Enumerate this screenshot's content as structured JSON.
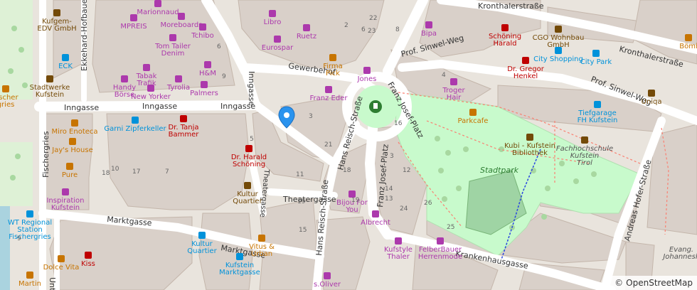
{
  "colors": {
    "background": "#e9e4dd",
    "building": "#d9d0c9",
    "road": "#ffffff",
    "park": "#c8facc",
    "shop_icon": "#ac39ac",
    "amenity_icon": "#734a08",
    "health_icon": "#bf0000",
    "transport_icon": "#0092da",
    "food_icon": "#c77400",
    "label": "#333333",
    "poi_label_shop": "#ac39ac",
    "poi_label_amenity": "#734a08",
    "poi_label_health": "#bf0000",
    "poi_label_transport": "#0092da",
    "poi_label_food": "#c77400",
    "marker": "#2a93ee"
  },
  "streets": [
    {
      "name": "Inngasse",
      "id": "inngasse-1"
    },
    {
      "name": "Inngasse",
      "id": "inngasse-2"
    },
    {
      "name": "Inngasse",
      "id": "inngasse-3"
    },
    {
      "name": "Inngasse",
      "id": "inngasse-vertical"
    },
    {
      "name": "Gewerbehof",
      "id": "gewerbehof"
    },
    {
      "name": "Franz Josef-Platz",
      "id": "franz-josef-platz-1"
    },
    {
      "name": "Franz Josef-Platz",
      "id": "franz-josef-platz-2"
    },
    {
      "name": "Hans Reisch-Straße",
      "id": "hans-reisch-1"
    },
    {
      "name": "Hans Reisch-Straße",
      "id": "hans-reisch-2"
    },
    {
      "name": "Prof. Sinwel-Weg",
      "id": "sinwel-1"
    },
    {
      "name": "Prof. Sinwel-Weg",
      "id": "sinwel-2"
    },
    {
      "name": "Kronthalerstraße",
      "id": "kronthaler-1"
    },
    {
      "name": "Kronthalerstraße",
      "id": "kronthaler-2"
    },
    {
      "name": "Marktgasse",
      "id": "marktgasse-1"
    },
    {
      "name": "Marktgasse",
      "id": "marktgasse-2"
    },
    {
      "name": "Theatergasse",
      "id": "theatergasse"
    },
    {
      "name": "Theatergasse",
      "id": "theatergasse-vertical"
    },
    {
      "name": "Krankenhausgasse",
      "id": "krankenhausgasse"
    },
    {
      "name": "Andreas Hofer-Straße",
      "id": "andreas-hofer"
    },
    {
      "name": "Fischergries",
      "id": "fischergries"
    },
    {
      "name": "Ekkehard-Hofbauer-Str.",
      "id": "ekkehard"
    },
    {
      "name": "Untere",
      "id": "untere"
    }
  ],
  "pois": [
    {
      "id": "kufgem",
      "name": "Kufgem-\nEDV GmbH",
      "cat": "amenity"
    },
    {
      "id": "marionnaud",
      "name": "Marionnaud",
      "cat": "shop"
    },
    {
      "id": "mpreis",
      "name": "MPREIS",
      "cat": "shop"
    },
    {
      "id": "moreboards",
      "name": "Moreboards",
      "cat": "shop"
    },
    {
      "id": "tchibo",
      "name": "Tchibo",
      "cat": "shop"
    },
    {
      "id": "libro",
      "name": "Libro",
      "cat": "shop"
    },
    {
      "id": "ruetz",
      "name": "Ruetz",
      "cat": "shop"
    },
    {
      "id": "eurospar",
      "name": "Eurospar",
      "cat": "shop"
    },
    {
      "id": "firma-pick",
      "name": "Firma\nPick",
      "cat": "food"
    },
    {
      "id": "jones",
      "name": "Jones",
      "cat": "shop"
    },
    {
      "id": "bipa",
      "name": "Bipa",
      "cat": "shop"
    },
    {
      "id": "schoening-harald-top",
      "name": "Schöning\nHarald",
      "cat": "health"
    },
    {
      "id": "cgo",
      "name": "CGO Wohnbau\nGmbH",
      "cat": "amenity"
    },
    {
      "id": "city-shopping",
      "name": "City Shopping",
      "cat": "transport"
    },
    {
      "id": "city-park",
      "name": "City Park",
      "cat": "transport"
    },
    {
      "id": "boemi",
      "name": "Bömi",
      "cat": "food"
    },
    {
      "id": "eck",
      "name": "ECK",
      "cat": "transport"
    },
    {
      "id": "tom-tailer",
      "name": "Tom Tailer\nDenim",
      "cat": "shop"
    },
    {
      "id": "tabak-trafik",
      "name": "Tabak\nTrafik",
      "cat": "shop"
    },
    {
      "id": "handy-boerse",
      "name": "Handy\nBörse",
      "cat": "shop"
    },
    {
      "id": "tyrolia",
      "name": "Tyrolia",
      "cat": "shop"
    },
    {
      "id": "hm",
      "name": "H&M",
      "cat": "shop"
    },
    {
      "id": "palmers",
      "name": "Palmers",
      "cat": "shop"
    },
    {
      "id": "new-yorker",
      "name": "New Yorker",
      "cat": "shop"
    },
    {
      "id": "stadtwerke",
      "name": "Stadtwerke\nKufstein",
      "cat": "amenity"
    },
    {
      "id": "fischer",
      "name": "Fischer\ngries",
      "cat": "food"
    },
    {
      "id": "franz-eder",
      "name": "Franz Eder",
      "cat": "shop"
    },
    {
      "id": "troger-hair",
      "name": "Troger\nHair",
      "cat": "shop"
    },
    {
      "id": "gregor-henkel",
      "name": "Dr. Gregor\nHenkel",
      "cat": "health"
    },
    {
      "id": "prof-sinwel",
      "name": "Prof. Sinwel-Weg",
      "cat": "label"
    },
    {
      "id": "uniqa",
      "name": "Uniqa",
      "cat": "amenity"
    },
    {
      "id": "parkcafe",
      "name": "Parkcafe",
      "cat": "food"
    },
    {
      "id": "tiefgarage",
      "name": "Tiefgarage\nFH Kufstein",
      "cat": "transport"
    },
    {
      "id": "garni-zipferkeller",
      "name": "Garni Zipferkeller",
      "cat": "transport"
    },
    {
      "id": "tanja-bammer",
      "name": "Dr. Tanja\nBammer",
      "cat": "health"
    },
    {
      "id": "miro-enoteca",
      "name": "Miro Enoteca",
      "cat": "food"
    },
    {
      "id": "jays-house",
      "name": "Jay's House",
      "cat": "food"
    },
    {
      "id": "harald-schoening",
      "name": "Dr. Harald\nSchöning",
      "cat": "health"
    },
    {
      "id": "kubi",
      "name": "Kubi - Kufstein\nBibliothek",
      "cat": "amenity"
    },
    {
      "id": "fachhochschule",
      "name": "Fachhochschule\nKufstein\nTirol",
      "cat": "amenity"
    },
    {
      "id": "stadtpark",
      "name": "Stadtpark",
      "cat": "park"
    },
    {
      "id": "pure",
      "name": "Pure",
      "cat": "food"
    },
    {
      "id": "kultur-quartier",
      "name": "Kultur\nQuartier",
      "cat": "amenity"
    },
    {
      "id": "bijou",
      "name": "Bijou For\nYou",
      "cat": "shop"
    },
    {
      "id": "inspiration",
      "name": "Inspiration\nKufstein",
      "cat": "shop"
    },
    {
      "id": "wt-regional",
      "name": "WT Regional\nStation\nFischergries",
      "cat": "transport"
    },
    {
      "id": "albrecht",
      "name": "Albrecht",
      "cat": "shop"
    },
    {
      "id": "kufstyle",
      "name": "Kufstyle\nThaler",
      "cat": "shop"
    },
    {
      "id": "felberbauer",
      "name": "FelberBauer\nHerrenmode",
      "cat": "shop"
    },
    {
      "id": "kultur-quartier-p",
      "name": "Kultur\nQuartier",
      "cat": "transport"
    },
    {
      "id": "vitus",
      "name": "Vitus &\nUrban",
      "cat": "food"
    },
    {
      "id": "kufstein-marktgasse",
      "name": "Kufstein\nMarktgasse",
      "cat": "transport"
    },
    {
      "id": "dolce-vita",
      "name": "Dolce Vita",
      "cat": "food"
    },
    {
      "id": "kiss",
      "name": "Kiss",
      "cat": "health"
    },
    {
      "id": "martin",
      "name": "Martin",
      "cat": "food"
    },
    {
      "id": "s-oliver",
      "name": "s.Oliver",
      "cat": "shop"
    },
    {
      "id": "evang",
      "name": "Evang.\nJohannesk",
      "cat": "label"
    }
  ],
  "housenumbers": [
    "2",
    "3",
    "3",
    "4",
    "5",
    "6",
    "6",
    "7",
    "8",
    "9",
    "9",
    "10",
    "11",
    "12",
    "13",
    "14",
    "15",
    "16",
    "17",
    "18",
    "18",
    "19",
    "19",
    "21",
    "22",
    "23",
    "24",
    "25",
    "26"
  ],
  "attribution": {
    "copyright": "©",
    "text": "OpenStreetMap"
  }
}
